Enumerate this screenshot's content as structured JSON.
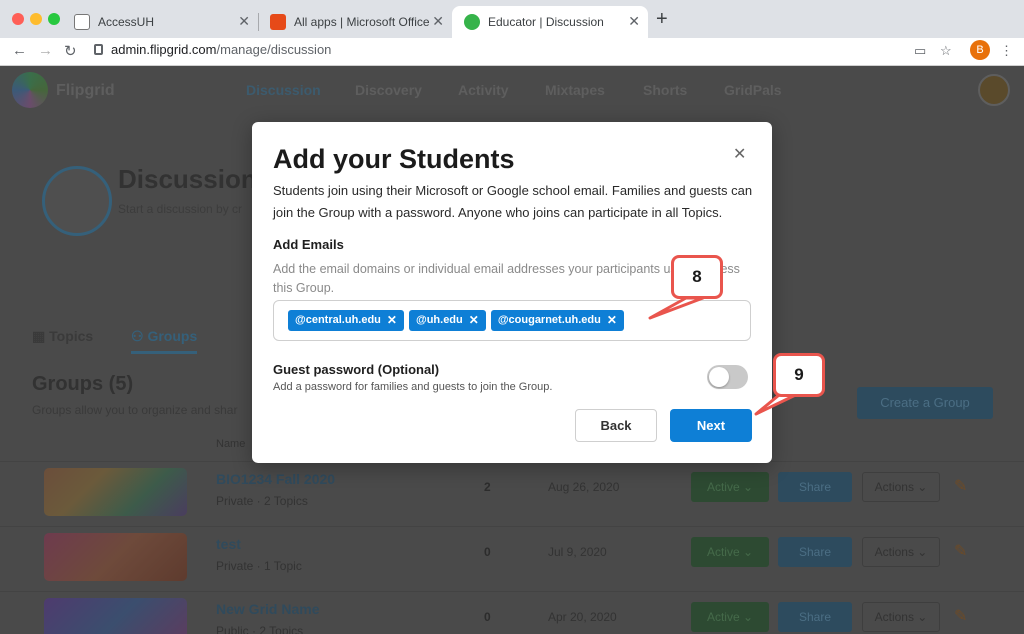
{
  "browser": {
    "tabs": [
      {
        "title": "AccessUH"
      },
      {
        "title": "All apps | Microsoft Office"
      },
      {
        "title": "Educator | Discussion"
      }
    ],
    "url_host": "admin.flipgrid.com",
    "url_path": "/manage/discussion",
    "profile_initial": "B"
  },
  "app": {
    "brand": "Flipgrid",
    "nav": [
      "Discussion",
      "Discovery",
      "Activity",
      "Mixtapes",
      "Shorts",
      "GridPals"
    ],
    "discussion_title": "Discussion",
    "discussion_subtitle": "Start a discussion by cr",
    "subtabs": [
      "Topics",
      "Groups"
    ],
    "groups_title": "Groups (5)",
    "groups_subtitle": "Groups allow you to organize and shar",
    "create_label": "Create a Group",
    "column_name": "Name",
    "rows": [
      {
        "name": "BIO1234 Fall 2020",
        "meta": "Private · 2 Topics",
        "count": "2",
        "date": "Aug 26, 2020"
      },
      {
        "name": "test",
        "meta": "Private · 1 Topic",
        "count": "0",
        "date": "Jul 9, 2020"
      },
      {
        "name": "New Grid Name",
        "meta": "Public · 2 Topics",
        "count": "0",
        "date": "Apr 20, 2020"
      }
    ],
    "row_labels": {
      "active": "Active ⌄",
      "share": "Share",
      "actions": "Actions ⌄"
    }
  },
  "modal": {
    "title": "Add your Students",
    "description": "Students join using their Microsoft or Google school email. Families and guests can join the Group with a password. Anyone who joins can participate in all Topics.",
    "emails_label": "Add Emails",
    "emails_hint": "Add the email domains or individual email addresses your participants use to access this Group.",
    "chips": [
      "@central.uh.edu",
      "@uh.edu",
      "@cougarnet.uh.edu"
    ],
    "guest_label": "Guest password (Optional)",
    "guest_sub": "Add a password for families and guests to join the Group.",
    "back_label": "Back",
    "next_label": "Next"
  },
  "annotations": {
    "first": "8",
    "second": "9"
  },
  "colors": {
    "accent": "#0e7fd6",
    "callout_border": "#e9554d"
  }
}
